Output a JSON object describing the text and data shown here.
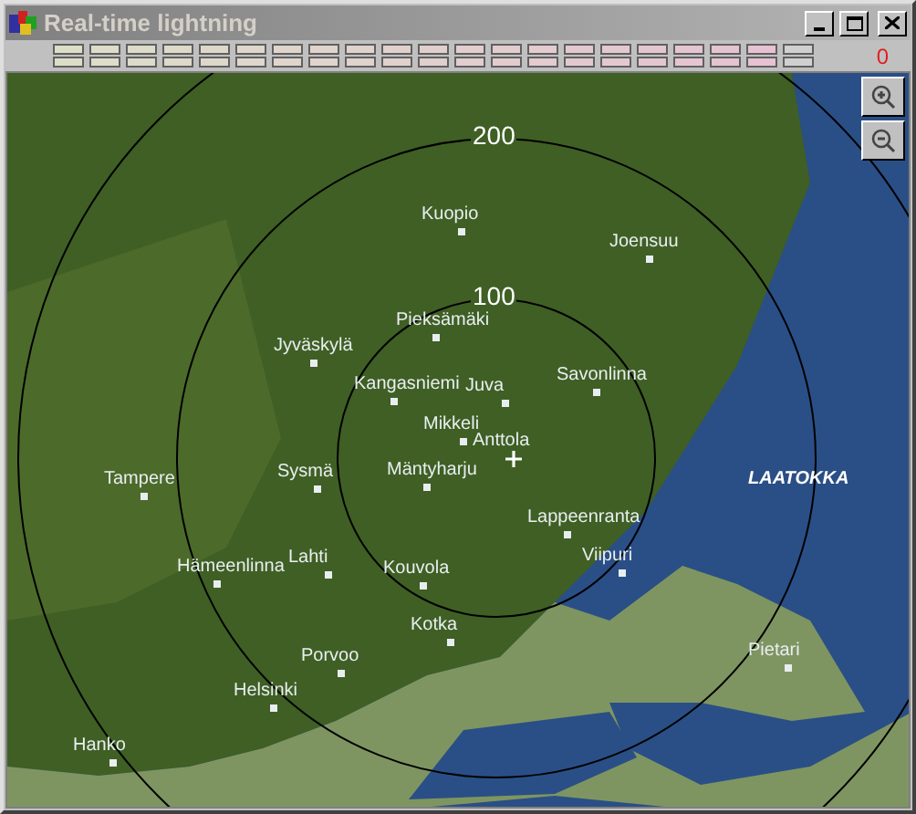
{
  "window": {
    "title": "Real-time lightning"
  },
  "counter": "0",
  "map": {
    "range_rings": [
      "200",
      "100"
    ],
    "places": [
      {
        "name": "Kuopio",
        "kind": "city"
      },
      {
        "name": "Joensuu",
        "kind": "city"
      },
      {
        "name": "Pieksämäki",
        "kind": "city"
      },
      {
        "name": "Jyväskylä",
        "kind": "city"
      },
      {
        "name": "Kangasniemi",
        "kind": "city"
      },
      {
        "name": "Juva",
        "kind": "city"
      },
      {
        "name": "Savonlinna",
        "kind": "city"
      },
      {
        "name": "Mikkeli",
        "kind": "city"
      },
      {
        "name": "Anttola",
        "kind": "station"
      },
      {
        "name": "Sysmä",
        "kind": "city"
      },
      {
        "name": "Mäntyharju",
        "kind": "city"
      },
      {
        "name": "Tampere",
        "kind": "city"
      },
      {
        "name": "Lappeenranta",
        "kind": "city"
      },
      {
        "name": "Viipuri",
        "kind": "city"
      },
      {
        "name": "Hämeenlinna",
        "kind": "city"
      },
      {
        "name": "Lahti",
        "kind": "city"
      },
      {
        "name": "Kouvola",
        "kind": "city"
      },
      {
        "name": "Kotka",
        "kind": "city"
      },
      {
        "name": "Porvoo",
        "kind": "city"
      },
      {
        "name": "Helsinki",
        "kind": "city"
      },
      {
        "name": "Hanko",
        "kind": "city"
      },
      {
        "name": "Pietari",
        "kind": "city"
      },
      {
        "name": "LAATOKKA",
        "kind": "lake"
      }
    ]
  }
}
